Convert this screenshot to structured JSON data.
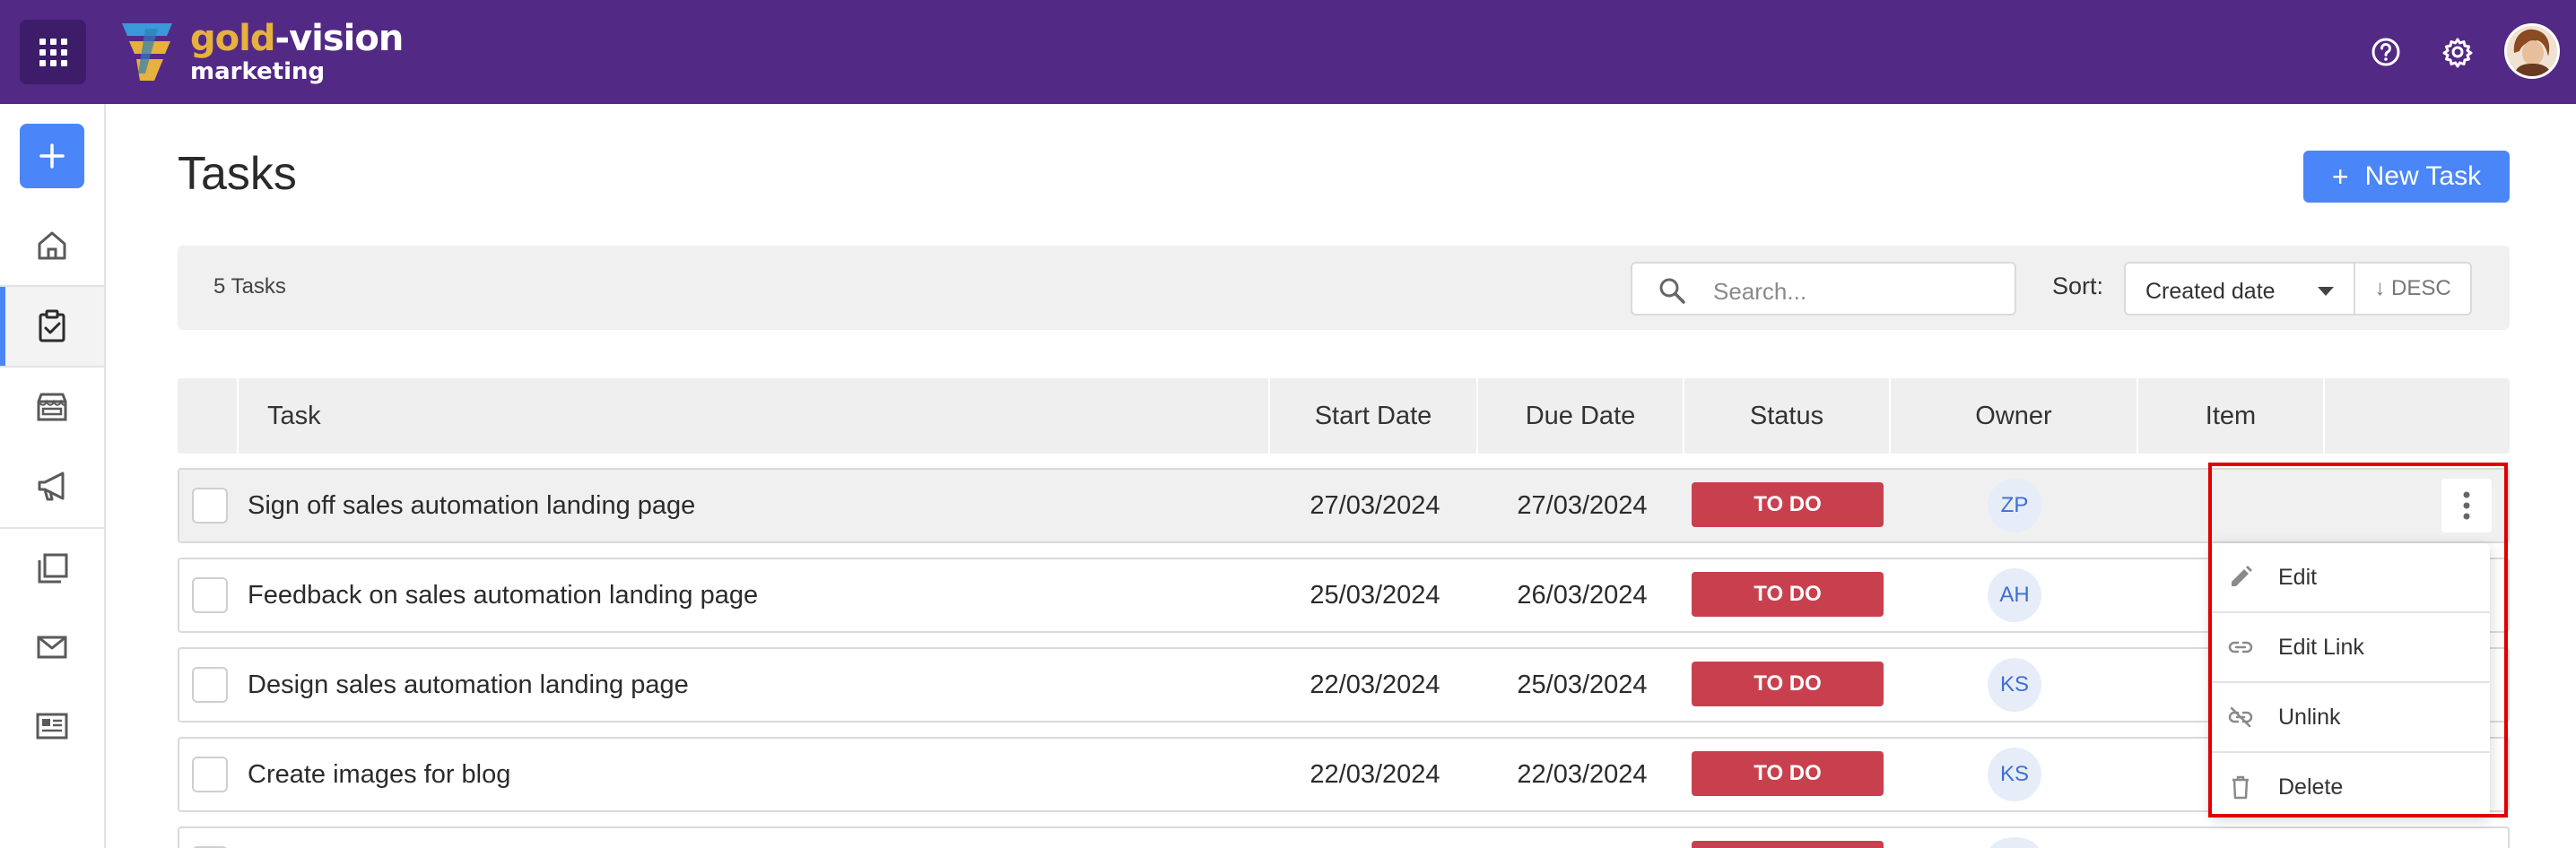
{
  "topbar": {
    "logo_line1_a": "gold",
    "logo_line1_b": "-vision",
    "logo_line2": "marketing",
    "icons": [
      "apps-icon",
      "help-icon",
      "settings-icon",
      "user-avatar"
    ]
  },
  "sidebar": {
    "items": [
      "add-icon",
      "home-icon",
      "tasks-icon",
      "store-icon",
      "campaign-icon",
      "pages-icon",
      "mail-icon",
      "forms-icon"
    ],
    "active": "tasks-icon"
  },
  "page": {
    "title": "Tasks",
    "new_task_label": "New Task"
  },
  "toolbar": {
    "task_count": "5 Tasks",
    "search_placeholder": "Search...",
    "sort_label": "Sort:",
    "sort_value": "Created date",
    "sort_direction": "↓ DESC"
  },
  "table": {
    "headers": [
      "Task",
      "Start Date",
      "Due Date",
      "Status",
      "Owner",
      "Item"
    ],
    "rows": [
      {
        "task": "Sign off sales automation landing page",
        "start": "27/03/2024",
        "due": "27/03/2024",
        "status": "TO DO",
        "owner": "ZP"
      },
      {
        "task": "Feedback on sales automation landing page",
        "start": "25/03/2024",
        "due": "26/03/2024",
        "status": "TO DO",
        "owner": "AH"
      },
      {
        "task": "Design sales automation landing page",
        "start": "22/03/2024",
        "due": "25/03/2024",
        "status": "TO DO",
        "owner": "KS"
      },
      {
        "task": "Create images for blog",
        "start": "22/03/2024",
        "due": "22/03/2024",
        "status": "TO DO",
        "owner": "KS"
      }
    ]
  },
  "context_menu": {
    "items": [
      {
        "label": "Edit",
        "icon": "pencil-icon"
      },
      {
        "label": "Edit Link",
        "icon": "link-icon"
      },
      {
        "label": "Unlink",
        "icon": "unlink-icon"
      },
      {
        "label": "Delete",
        "icon": "trash-icon"
      }
    ]
  },
  "colors": {
    "topbar": "#522a85",
    "accent": "#4a86f7",
    "status_todo": "#c8404e",
    "highlight": "#e10000",
    "logo_gold": "#e7b13d"
  }
}
